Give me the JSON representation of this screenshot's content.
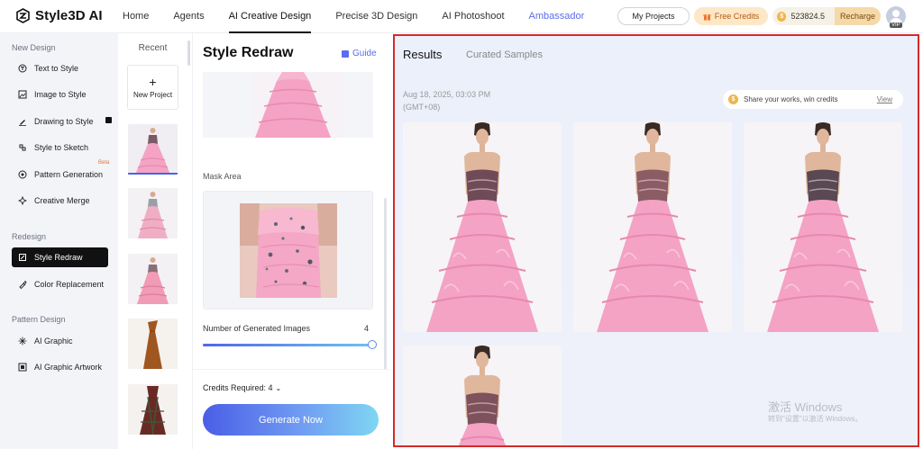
{
  "app": {
    "name": "Style3D AI"
  },
  "nav": {
    "items": [
      "Home",
      "Agents",
      "AI Creative Design",
      "Precise 3D Design",
      "AI Photoshoot",
      "Ambassador"
    ],
    "active": "AI Creative Design"
  },
  "header": {
    "my_projects": "My Projects",
    "free_credits": "Free Credits",
    "credits_balance": "523824.5",
    "recharge": "Recharge",
    "vip_badge": "VIP"
  },
  "sidebar": {
    "sections": [
      {
        "title": "New Design",
        "items": [
          "Text to Style",
          "Image to Style",
          "Drawing to Style",
          "Style to Sketch",
          "Pattern Generation",
          "Creative Merge"
        ]
      },
      {
        "title": "Redesign",
        "items": [
          "Style Redraw",
          "Color Replacement"
        ]
      },
      {
        "title": "Pattern Design",
        "items": [
          "AI Graphic",
          "AI Graphic Artwork"
        ]
      }
    ],
    "active": "Style Redraw",
    "beta_label": "Beta"
  },
  "recent": {
    "title": "Recent",
    "new_project": "New Project",
    "plus": "+"
  },
  "panel": {
    "title": "Style Redraw",
    "guide": "Guide",
    "mask_area_label": "Mask Area",
    "num_images_label": "Number of Generated Images",
    "num_images_value": "4",
    "num_images_fraction": 1.0,
    "credits_required": "Credits Required: 4",
    "generate_button": "Generate Now"
  },
  "results": {
    "tabs": [
      "Results",
      "Curated Samples"
    ],
    "date": "Aug 18, 2025, 03:03 PM (GMT+08)",
    "share_text": "Share your works, win credits",
    "share_view": "View"
  },
  "watermark": {
    "line1": "激活 Windows",
    "line2": "转到\"设置\"以激活 Windows。"
  },
  "colors": {
    "accent": "#5b6cf0",
    "highlight_border": "#d42a2a",
    "dress_pink": "#f4a3c4",
    "sidebar_bg": "#f3f4f8"
  }
}
